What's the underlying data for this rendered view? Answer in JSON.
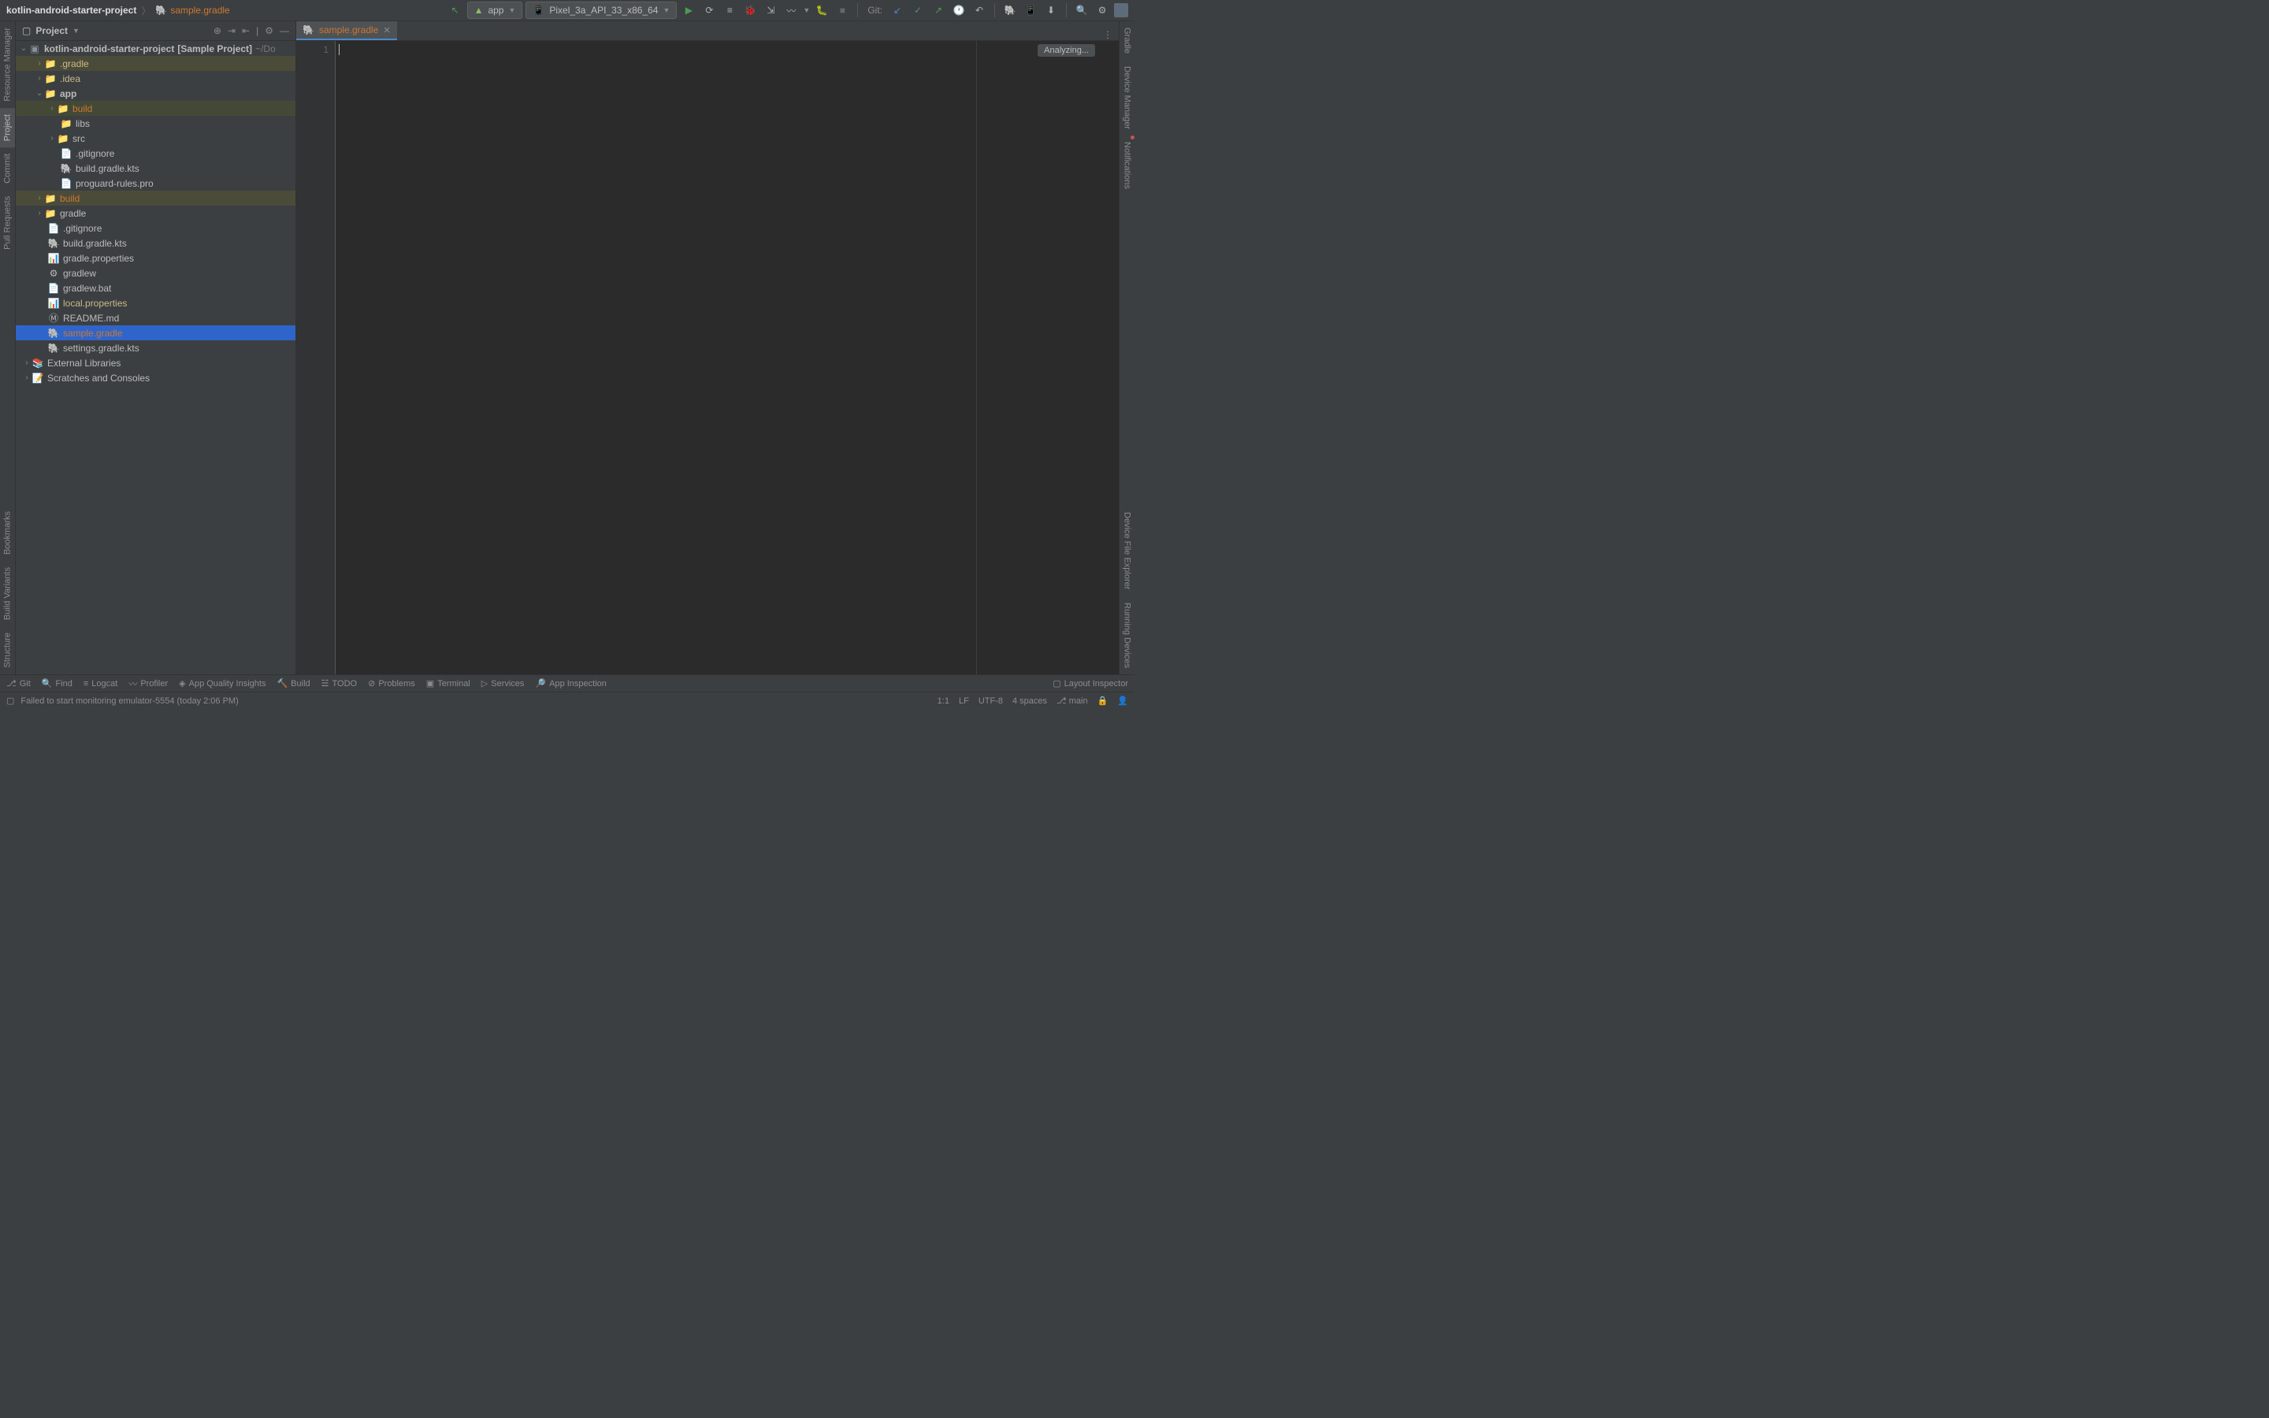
{
  "breadcrumb": {
    "project": "kotlin-android-starter-project",
    "file": "sample.gradle"
  },
  "run_config": {
    "app": "app",
    "device": "Pixel_3a_API_33_x86_64"
  },
  "git_label": "Git:",
  "panel": {
    "title": "Project"
  },
  "tree": {
    "root": "kotlin-android-starter-project",
    "root_suffix": "[Sample Project]",
    "root_path": "~/Do",
    "gradle_dir": ".gradle",
    "idea_dir": ".idea",
    "app_dir": "app",
    "app_build": "build",
    "app_libs": "libs",
    "app_src": "src",
    "app_gitignore": ".gitignore",
    "app_build_gradle": "build.gradle.kts",
    "app_proguard": "proguard-rules.pro",
    "build_dir": "build",
    "gradle_root": "gradle",
    "gitignore": ".gitignore",
    "build_gradle": "build.gradle.kts",
    "gradle_props": "gradle.properties",
    "gradlew": "gradlew",
    "gradlew_bat": "gradlew.bat",
    "local_props": "local.properties",
    "readme": "README.md",
    "sample_gradle": "sample.gradle",
    "settings_gradle": "settings.gradle.kts",
    "ext_libs": "External Libraries",
    "scratches": "Scratches and Consoles"
  },
  "editor": {
    "tab_name": "sample.gradle",
    "line_number": "1",
    "analyzing": "Analyzing..."
  },
  "left_tabs": {
    "resource_manager": "Resource Manager",
    "project": "Project",
    "commit": "Commit",
    "pull_requests": "Pull Requests",
    "bookmarks": "Bookmarks",
    "build_variants": "Build Variants",
    "structure": "Structure"
  },
  "right_tabs": {
    "gradle": "Gradle",
    "device_manager": "Device Manager",
    "notifications": "Notifications",
    "device_file_explorer": "Device File Explorer",
    "running_devices": "Running Devices"
  },
  "bottom": {
    "git": "Git",
    "find": "Find",
    "logcat": "Logcat",
    "profiler": "Profiler",
    "app_quality": "App Quality Insights",
    "build": "Build",
    "todo": "TODO",
    "problems": "Problems",
    "terminal": "Terminal",
    "services": "Services",
    "app_inspection": "App Inspection",
    "layout_inspector": "Layout Inspector"
  },
  "status": {
    "message": "Failed to start monitoring emulator-5554 (today 2:06 PM)",
    "pos": "1:1",
    "line_sep": "LF",
    "encoding": "UTF-8",
    "indent": "4 spaces",
    "branch": "main"
  }
}
